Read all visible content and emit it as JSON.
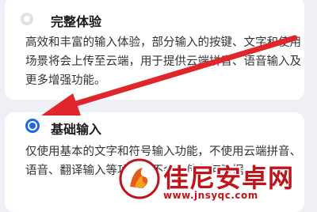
{
  "options": [
    {
      "title": "完整体验",
      "description": "高效和丰富的输入体验，部分输入的按键、文字和使用场景将会上传至云端，用于提供云端拼音、语音输入及更多增强功能。",
      "selected": false
    },
    {
      "title": "基础输入",
      "description": "仅使用基本的文字和符号输入功能，不使用云端拼音、语音、翻译输入等功能，不会上传任何数据。",
      "selected": true
    }
  ],
  "annotation": {
    "arrow_color": "#e0262a",
    "points_to": "基础输入"
  },
  "watermark": {
    "name": "佳尼安卓网",
    "url": "www.jnsyqc.com",
    "color": "#c0141c"
  },
  "colors": {
    "accent": "#1f67e6",
    "background": "#eef0f5"
  }
}
